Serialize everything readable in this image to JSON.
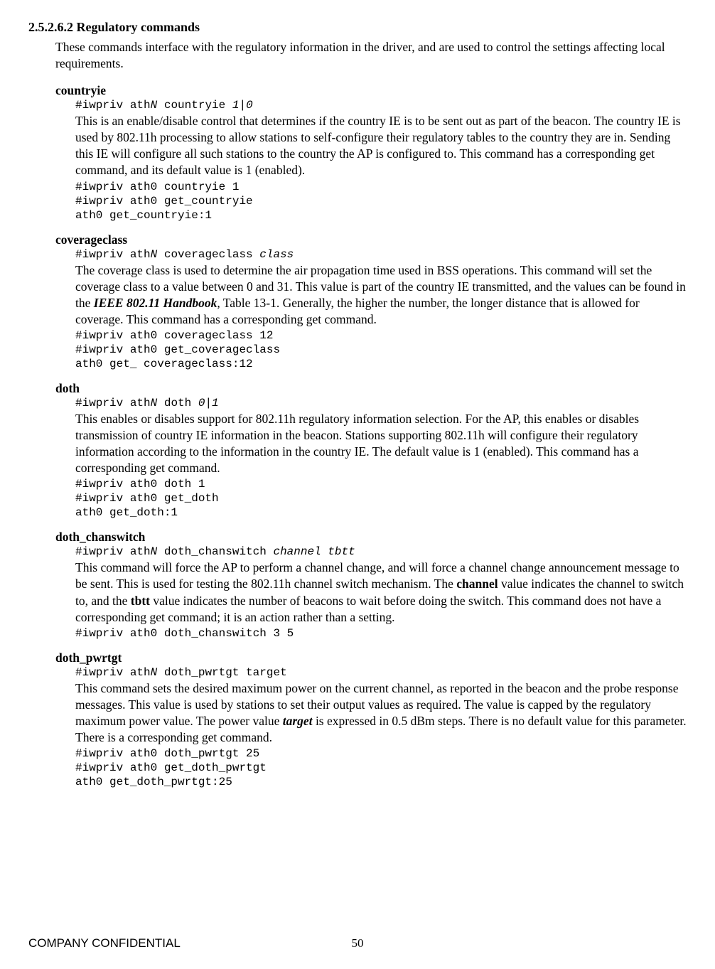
{
  "section": {
    "title": "2.5.2.6.2 Regulatory commands",
    "intro": "These commands interface with the regulatory information in the driver, and are used to control the settings affecting local requirements."
  },
  "commands": {
    "c0": {
      "name": "countryie",
      "syn_pre": "#iwpriv ath",
      "syn_N": "N",
      "syn_post": " countryie ",
      "syn_args": "1|0",
      "desc": "This is an enable/disable control that determines if the country IE is to be sent out as part of the beacon. The country IE is used by 802.11h processing to allow stations to self-configure their regulatory tables to the country they are in. Sending this IE will configure all such stations to the country the AP is configured to. This command has a corresponding get command, and its default value is 1 (enabled).",
      "ex": "#iwpriv ath0 countryie 1\n#iwpriv ath0 get_countryie\nath0 get_countryie:1"
    },
    "c1": {
      "name": "coverageclass",
      "syn_pre": "#iwpriv ath",
      "syn_N": "N",
      "syn_post": " coverageclass ",
      "syn_args": "class",
      "desc_pre": "The coverage class is used to determine the air propagation time used in BSS operations. This command will set the coverage class to a value between 0 and 31. This value is part of the country IE transmitted, and the values can be found in the ",
      "desc_bi": "IEEE 802.11 Handbook",
      "desc_post": ", Table 13-1. Generally, the higher the number, the longer distance that is allowed for coverage. This command has a corresponding get command.",
      "ex": "#iwpriv ath0 coverageclass 12\n#iwpriv ath0 get_coverageclass\nath0 get_ coverageclass:12"
    },
    "c2": {
      "name": "doth",
      "syn_pre": "#iwpriv ath",
      "syn_N": "N",
      "syn_post": " doth ",
      "syn_args": "0|1",
      "desc": "This enables or disables support for 802.11h regulatory information selection. For the AP, this enables or disables transmission of country IE information in the beacon. Stations supporting 802.11h will configure their regulatory information according to the information in the country IE. The default value is 1 (enabled). This command has a corresponding get command.",
      "ex": "#iwpriv ath0 doth 1\n#iwpriv ath0 get_doth\nath0 get_doth:1"
    },
    "c3": {
      "name": "doth_chanswitch",
      "syn_pre": "#iwpriv ath",
      "syn_N": "N",
      "syn_post": " doth_chanswitch ",
      "syn_args": "channel tbtt",
      "d1": "This command will force the AP to perform a channel change, and will force a channel change announcement message to be sent. This is used for testing the 802.11h channel switch mechanism. The ",
      "b1": "channel",
      "d2": " value indicates the channel to switch to, and the ",
      "b2": "tbtt",
      "d3": " value indicates the number of beacons to wait before doing the switch. This command does not have a corresponding get command; it is an action rather than a setting.",
      "ex": "#iwpriv ath0 doth_chanswitch 3 5"
    },
    "c4": {
      "name": "doth_pwrtgt",
      "syn_pre": "#iwpriv ath",
      "syn_N": "N",
      "syn_post": " doth_pwrtgt target",
      "d1": "This command sets the desired maximum power on the current channel, as reported in the beacon and the probe response messages. This value is used by stations to set their output values as required. The value is capped by the regulatory maximum power value. The power value ",
      "bi": "target",
      "d2": " is expressed in 0.5 dBm steps. There is no default value for this parameter. There is a corresponding get command.",
      "ex": "#iwpriv ath0 doth_pwrtgt 25\n#iwpriv ath0 get_doth_pwrtgt\nath0 get_doth_pwrtgt:25"
    }
  },
  "footer": {
    "left": "COMPANY CONFIDENTIAL",
    "page": "50"
  }
}
